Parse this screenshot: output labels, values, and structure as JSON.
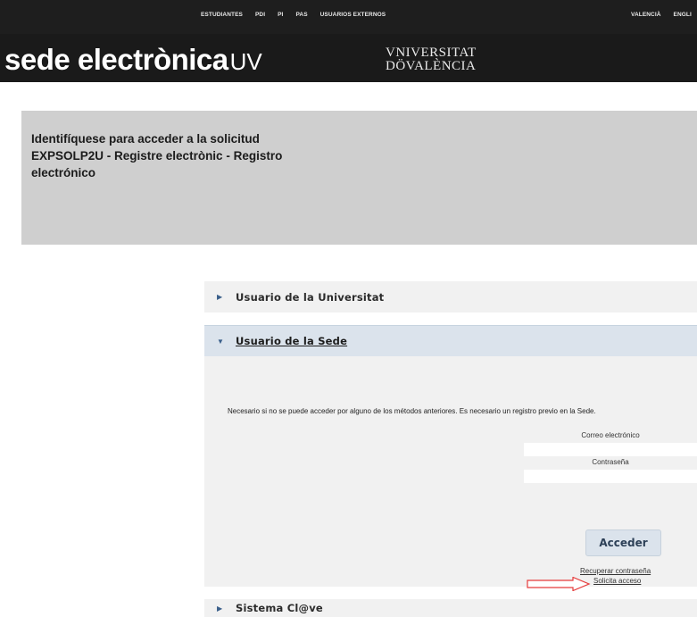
{
  "topbar": {
    "nav": [
      "ESTUDIANTES",
      "PDI",
      "PI",
      "PAS",
      "USUARIOS EXTERNOS"
    ],
    "languages": [
      "VALENCIÀ",
      "ENGLI"
    ]
  },
  "header": {
    "brand_main": "sede electrònica",
    "brand_suffix": "UV",
    "university_line1": "VNIVERSITAT",
    "university_line2": "DÖVALÈNCIA"
  },
  "identify": {
    "title": "Identifíquese para acceder a la solicitud EXPSOLP2U - Registre electrònic - Registro electrónico"
  },
  "sections": {
    "universitat": "Usuario de la Universitat",
    "sede": "Usuario de la Sede",
    "clave": "Sistema Cl@ve"
  },
  "sede_form": {
    "note": "Necesario si no se puede acceder por alguno de los métodos anteriores. Es necesario un registro previo en la Sede.",
    "email_label": "Correo electrónico",
    "email_value": "",
    "password_label": "Contraseña",
    "password_value": "",
    "submit": "Acceder",
    "recover_link": "Recuperar contraseña",
    "request_link": "Solicita acceso"
  },
  "icons": {
    "collapsed": "triangle-right-icon",
    "expanded": "triangle-down-icon",
    "annotation": "red-arrow-icon"
  },
  "colors": {
    "topbar": "#1e1e1e",
    "panel": "#cfcfcf",
    "accordion": "#f1f1f1",
    "accordion_active": "#dbe3ec",
    "arrow": "#e53b3b"
  }
}
